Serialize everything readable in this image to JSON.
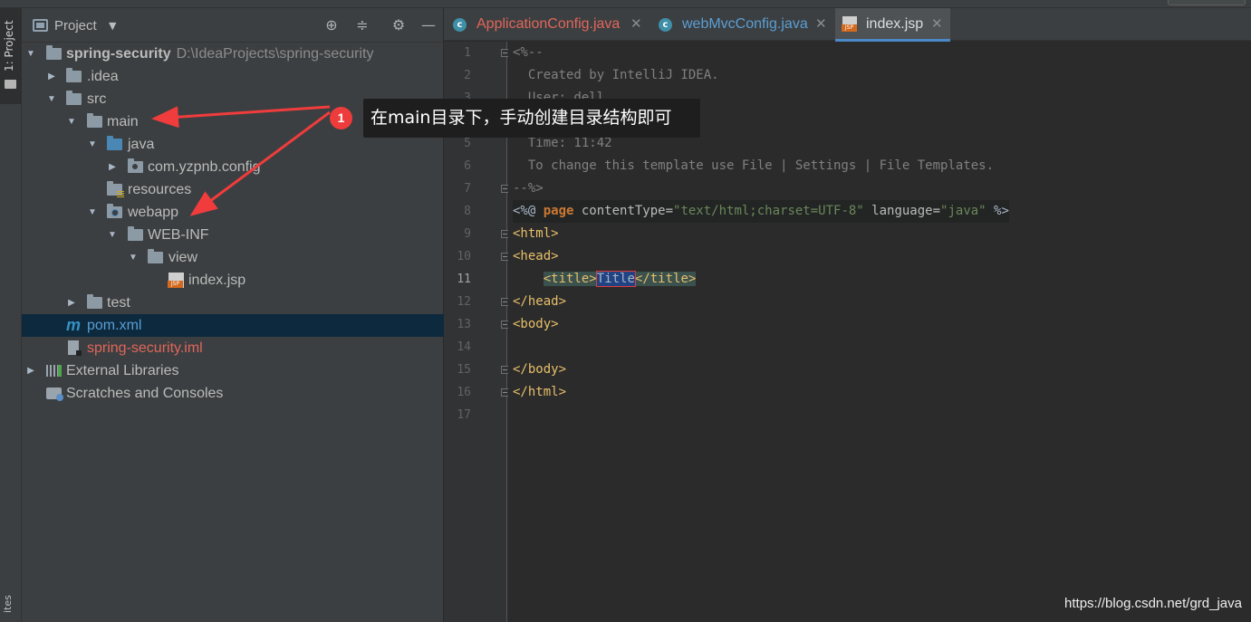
{
  "stripe": {
    "tab_label": "1: Project",
    "bottom_label": "ites"
  },
  "project_panel": {
    "title": "Project",
    "tree": [
      {
        "label": "spring-security",
        "path": "D:\\IdeaProjects\\spring-security"
      },
      {
        "label": ".idea"
      },
      {
        "label": "src"
      },
      {
        "label": "main"
      },
      {
        "label": "java"
      },
      {
        "label": "com.yzpnb.config"
      },
      {
        "label": "resources"
      },
      {
        "label": "webapp"
      },
      {
        "label": "WEB-INF"
      },
      {
        "label": "view"
      },
      {
        "label": "index.jsp"
      },
      {
        "label": "test"
      },
      {
        "label": "pom.xml"
      },
      {
        "label": "spring-security.iml"
      },
      {
        "label": "External Libraries"
      },
      {
        "label": "Scratches and Consoles"
      }
    ]
  },
  "annotation": {
    "badge": "1",
    "text": "在main目录下，手动创建目录结构即可"
  },
  "tabs": [
    {
      "label": "ApplicationConfig.java",
      "icon": "class-icon",
      "color": "#e0665b"
    },
    {
      "label": "webMvcConfig.java",
      "icon": "class-icon",
      "color": "#5a9fd4"
    },
    {
      "label": "index.jsp",
      "icon": "jsp-icon",
      "active": true
    }
  ],
  "editor": {
    "line_numbers": [
      "1",
      "2",
      "3",
      "4",
      "5",
      "6",
      "7",
      "8",
      "9",
      "10",
      "11",
      "12",
      "13",
      "14",
      "15",
      "16",
      "17"
    ],
    "current_line": "11",
    "lines": {
      "l1": "<%--",
      "l2": "  Created by IntelliJ IDEA.",
      "l3": "  User: dell",
      "l5": "  Time: 11:42",
      "l6": "  To change this template use File | Settings | File Templates.",
      "l7": "--%>",
      "l8_open": "<%@ ",
      "l8_kw": "page",
      "l8_attr1": " contentType=",
      "l8_val1": "\"text/html;charset=UTF-8\"",
      "l8_attr2": " language=",
      "l8_val2": "\"java\"",
      "l8_close": " %>",
      "l9": "<html>",
      "l10": "<head>",
      "l11_indent": "    ",
      "l11_open": "<title>",
      "l11_text": "Title",
      "l11_close": "</title>",
      "l12": "</head>",
      "l13": "<body>",
      "l15": "</body>",
      "l16": "</html>"
    }
  },
  "watermark": "https://blog.csdn.net/grd_java"
}
